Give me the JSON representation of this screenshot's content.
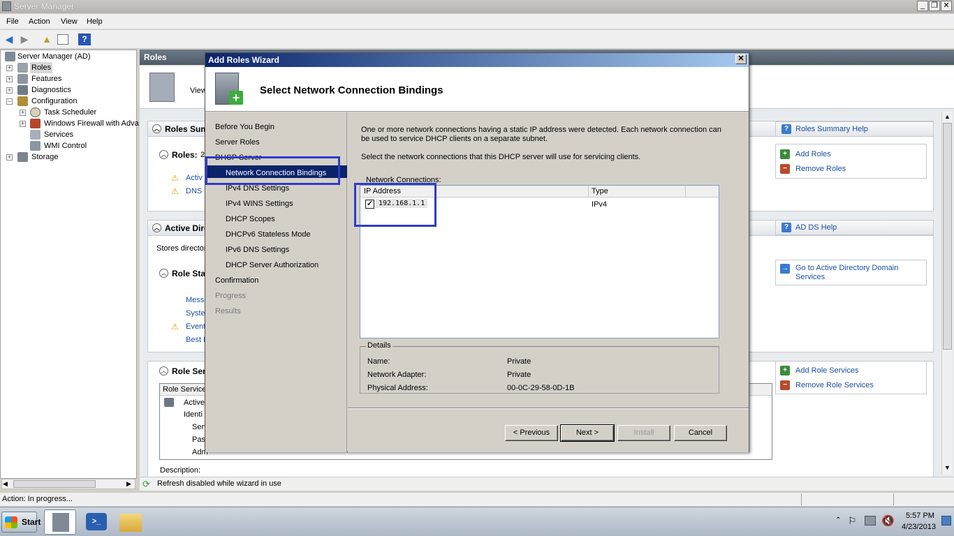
{
  "window": {
    "title": "Server Manager"
  },
  "menu": [
    "File",
    "Action",
    "View",
    "Help"
  ],
  "tree": {
    "root": "Server Manager (AD)",
    "items": [
      "Roles",
      "Features",
      "Diagnostics",
      "Configuration",
      "Task Scheduler",
      "Windows Firewall with Adva",
      "Services",
      "WMI Control",
      "Storage"
    ]
  },
  "main": {
    "header": "Roles",
    "view_text": "View",
    "roles_summary": "Roles Sum",
    "roles_label": "Roles:",
    "roles_count": "2",
    "role_links": [
      "Activ",
      "DNS S"
    ],
    "active_dir": "Active Dire",
    "stores_text": "Stores director",
    "role_status": "Role Sta",
    "status_links": [
      "Messa",
      "Syste",
      "Event",
      "Best P"
    ],
    "role_services": "Role Ser",
    "rs_column": "Role Service",
    "rs_rows": [
      "Active",
      "Identi",
      "Serv",
      "Pass",
      "Adm"
    ],
    "description_label": "Description:"
  },
  "actions": {
    "roles_summary_help": "Roles Summary Help",
    "add_roles": "Add Roles",
    "remove_roles": "Remove Roles",
    "ad_ds_help": "AD DS Help",
    "goto_ad": "Go to Active Directory Domain Services",
    "add_role_services": "Add Role Services",
    "remove_role_services": "Remove Role Services"
  },
  "status": {
    "refresh": "Refresh disabled while wizard in use",
    "action": "Action:  In progress..."
  },
  "wizard": {
    "title": "Add Roles Wizard",
    "heading": "Select Network Connection Bindings",
    "nav": [
      "Before You Begin",
      "Server Roles",
      "DHCP Server",
      "Network Connection Bindings",
      "IPv4 DNS Settings",
      "IPv4 WINS Settings",
      "DHCP Scopes",
      "DHCPv6 Stateless Mode",
      "IPv6 DNS Settings",
      "DHCP Server Authorization",
      "Confirmation",
      "Progress",
      "Results"
    ],
    "intro": "One or more network connections having a static IP address were detected. Each network connection can be used to service DHCP clients on a separate subnet.",
    "select_text": "Select the network connections that this DHCP server will use for servicing clients.",
    "connections_label": "Network Connections:",
    "columns": [
      "IP Address",
      "Type"
    ],
    "rows": [
      {
        "ip": "192.168.1.1",
        "type": "IPv4",
        "checked": true
      }
    ],
    "details_label": "Details",
    "details": [
      {
        "k": "Name:",
        "v": "Private"
      },
      {
        "k": "Network Adapter:",
        "v": "Private"
      },
      {
        "k": "Physical Address:",
        "v": "00-0C-29-58-0D-1B"
      }
    ],
    "buttons": {
      "previous": "< Previous",
      "next": "Next >",
      "install": "Install",
      "cancel": "Cancel"
    }
  },
  "taskbar": {
    "start": "Start",
    "time": "5:57 PM",
    "date": "4/23/2013"
  }
}
